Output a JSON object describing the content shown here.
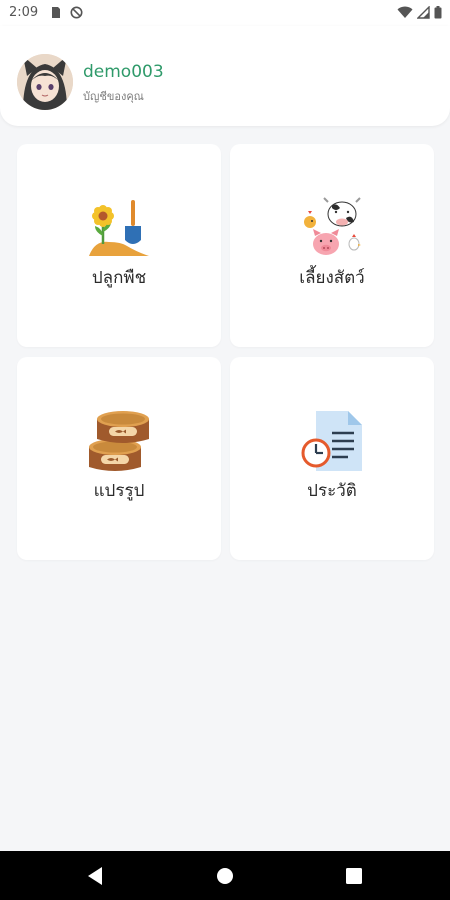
{
  "status_bar": {
    "time": "2:09",
    "icons": [
      "sim-card-icon",
      "no-entry-icon",
      "wifi-icon",
      "cellular-signal-icon",
      "battery-icon"
    ]
  },
  "profile": {
    "username": "demo003",
    "subtitle": "บัญชีของคุณ",
    "avatar": "avatar-image"
  },
  "menu": [
    {
      "label": "ปลูกพืช",
      "icon": "plant-sprout-icon"
    },
    {
      "label": "เลี้ยงสัตว์",
      "icon": "farm-animals-icon"
    },
    {
      "label": "แปรรูป",
      "icon": "canned-food-icon"
    },
    {
      "label": "ประวัติ",
      "icon": "history-document-icon"
    }
  ],
  "nav": {
    "buttons": [
      "back-icon",
      "home-icon",
      "recent-apps-icon"
    ]
  },
  "colors": {
    "accent": "#2f9a6a",
    "background": "#f5f6f8",
    "card": "#ffffff"
  }
}
